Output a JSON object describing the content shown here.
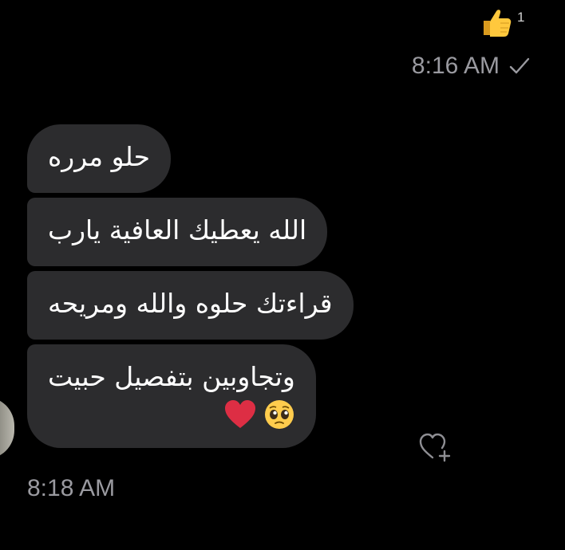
{
  "reaction": {
    "icon": "thumbs-up-icon",
    "count": "1"
  },
  "sent_message": {
    "time": "8:16 AM",
    "status_icon": "check-icon"
  },
  "received_messages": [
    {
      "text": "حلو مرره"
    },
    {
      "text": "الله يعطيك العافية يارب"
    },
    {
      "text": "قراءتك حلوه والله ومريحه"
    },
    {
      "text": "وتجاوبين بتفصيل حبيت",
      "emojis": [
        "pleading-face-icon",
        "red-heart-icon"
      ]
    }
  ],
  "received_time": "8:18 AM",
  "react_button_icon": "heart-plus-icon",
  "colors": {
    "background": "#000000",
    "bubble": "#2c2c2e",
    "timestamp": "#9a9aa0",
    "text": "#ffffff"
  }
}
